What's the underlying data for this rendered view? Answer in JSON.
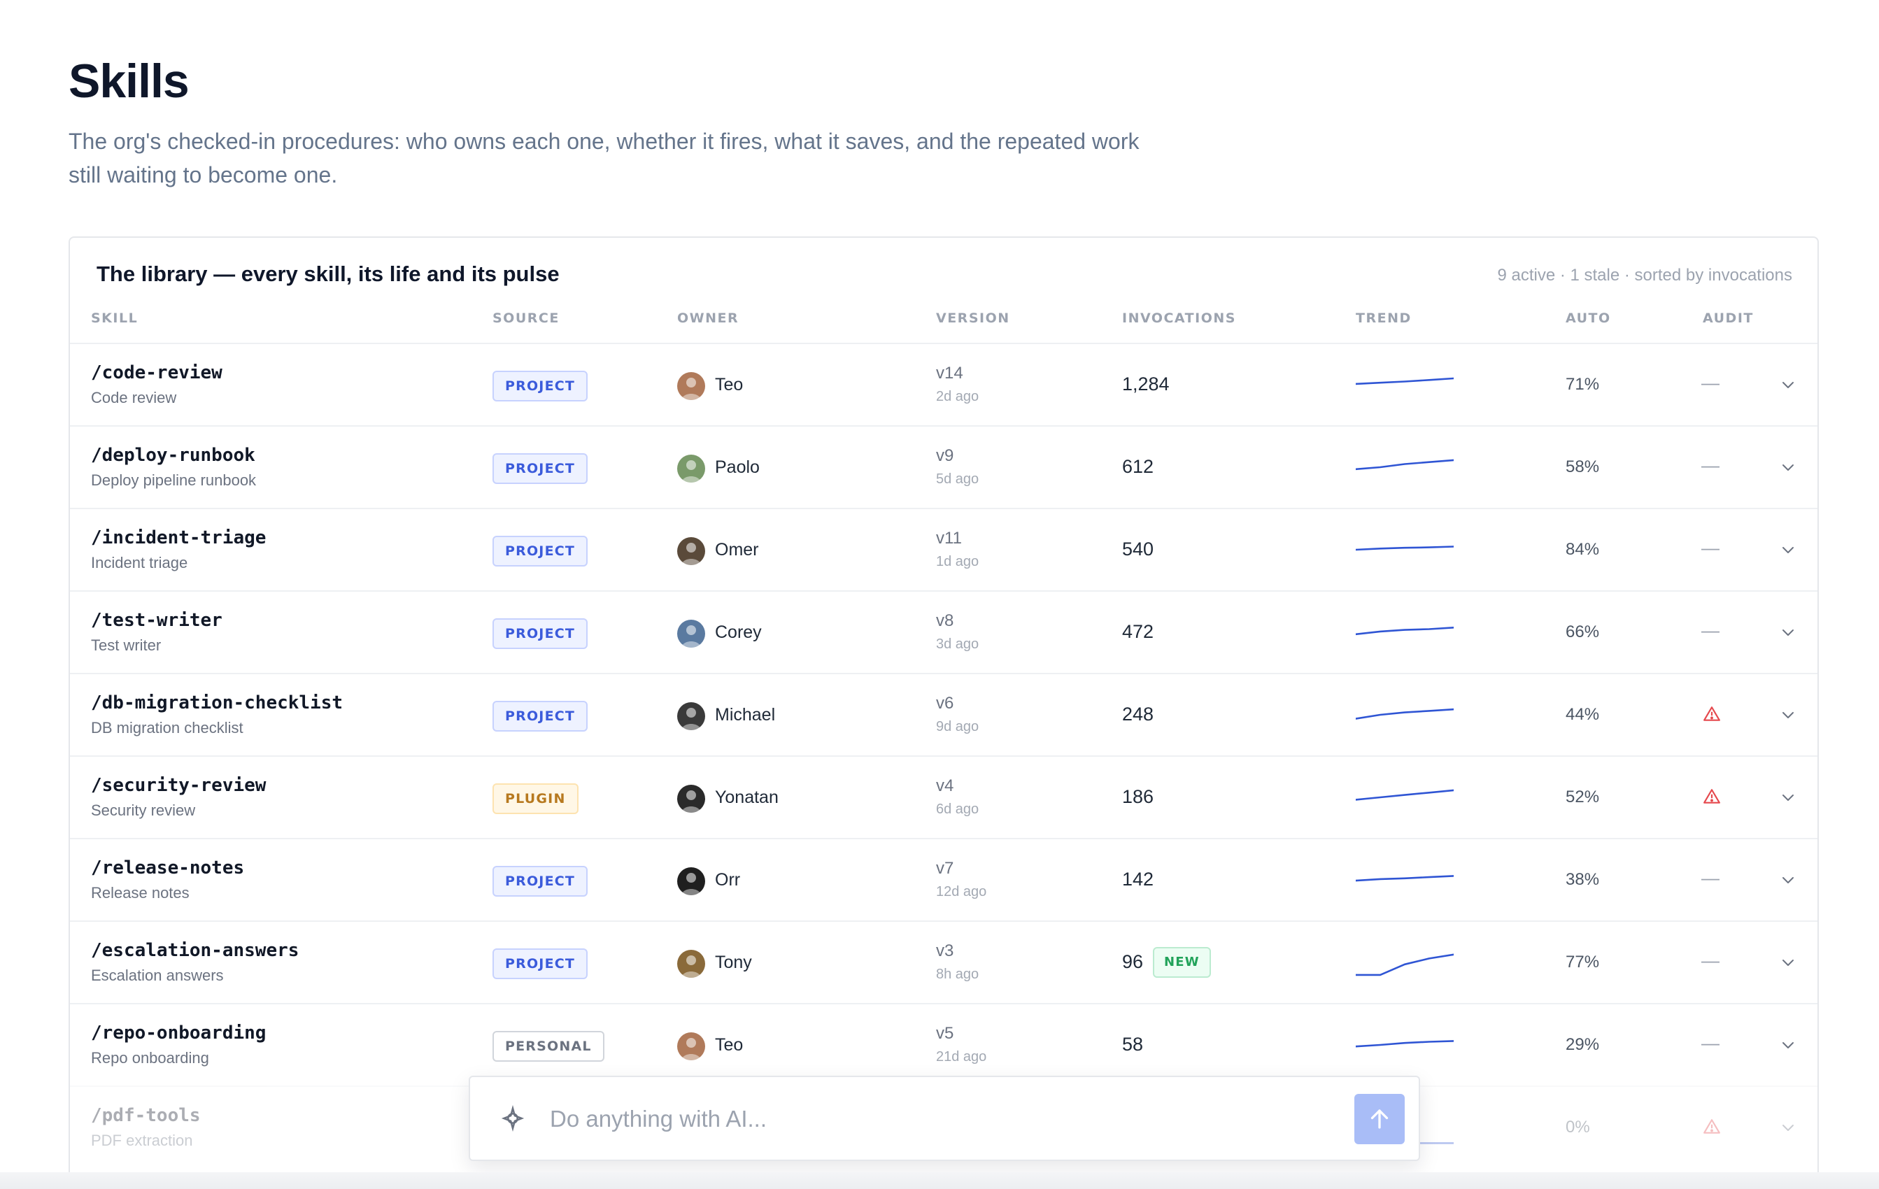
{
  "header": {
    "title": "Skills",
    "description": "The org's checked-in procedures: who owns each one, whether it fires, what it saves, and the repeated work still waiting to become one."
  },
  "library": {
    "title": "The library — every skill, its life and its pulse",
    "meta": "9 active · 1 stale · sorted by invocations",
    "columns": {
      "skill": "SKILL",
      "source": "SOURCE",
      "owner": "OWNER",
      "version": "VERSION",
      "invocations": "INVOCATIONS",
      "trend": "TREND",
      "auto": "AUTO",
      "audit": "AUDIT"
    },
    "rows": [
      {
        "name": "/code-review",
        "desc": "Code review",
        "source": "PROJECT",
        "source_kind": "project",
        "owner": "Teo",
        "avatar_color": "#b07a5a",
        "version": "v14",
        "ago": "2d ago",
        "invocations": "1,284",
        "is_new": false,
        "trend": [
          0.48,
          0.45,
          0.42,
          0.38,
          0.34
        ],
        "auto": "71%",
        "audit": "none",
        "faded": false
      },
      {
        "name": "/deploy-runbook",
        "desc": "Deploy pipeline runbook",
        "source": "PROJECT",
        "source_kind": "project",
        "owner": "Paolo",
        "avatar_color": "#7a9a6a",
        "version": "v9",
        "ago": "5d ago",
        "invocations": "612",
        "is_new": false,
        "trend": [
          0.55,
          0.5,
          0.42,
          0.37,
          0.32
        ],
        "auto": "58%",
        "audit": "none",
        "faded": false
      },
      {
        "name": "/incident-triage",
        "desc": "Incident triage",
        "source": "PROJECT",
        "source_kind": "project",
        "owner": "Omer",
        "avatar_color": "#5a4a3a",
        "version": "v11",
        "ago": "1d ago",
        "invocations": "540",
        "is_new": false,
        "trend": [
          0.5,
          0.47,
          0.45,
          0.44,
          0.42
        ],
        "auto": "84%",
        "audit": "none",
        "faded": false
      },
      {
        "name": "/test-writer",
        "desc": "Test writer",
        "source": "PROJECT",
        "source_kind": "project",
        "owner": "Corey",
        "avatar_color": "#5a7aa0",
        "version": "v8",
        "ago": "3d ago",
        "invocations": "472",
        "is_new": false,
        "trend": [
          0.55,
          0.48,
          0.44,
          0.42,
          0.38
        ],
        "auto": "66%",
        "audit": "none",
        "faded": false
      },
      {
        "name": "/db-migration-checklist",
        "desc": "DB migration checklist",
        "source": "PROJECT",
        "source_kind": "project",
        "owner": "Michael",
        "avatar_color": "#3a3a3a",
        "version": "v6",
        "ago": "9d ago",
        "invocations": "248",
        "is_new": false,
        "trend": [
          0.6,
          0.5,
          0.44,
          0.4,
          0.36
        ],
        "auto": "44%",
        "audit": "warning",
        "faded": false
      },
      {
        "name": "/security-review",
        "desc": "Security review",
        "source": "PLUGIN",
        "source_kind": "plugin",
        "owner": "Yonatan",
        "avatar_color": "#2a2a2a",
        "version": "v4",
        "ago": "6d ago",
        "invocations": "186",
        "is_new": false,
        "trend": [
          0.56,
          0.5,
          0.44,
          0.38,
          0.32
        ],
        "auto": "52%",
        "audit": "warning",
        "faded": false
      },
      {
        "name": "/release-notes",
        "desc": "Release notes",
        "source": "PROJECT",
        "source_kind": "project",
        "owner": "Orr",
        "avatar_color": "#1f1f1f",
        "version": "v7",
        "ago": "12d ago",
        "invocations": "142",
        "is_new": false,
        "trend": [
          0.52,
          0.48,
          0.46,
          0.43,
          0.4
        ],
        "auto": "38%",
        "audit": "none",
        "faded": false
      },
      {
        "name": "/escalation-answers",
        "desc": "Escalation answers",
        "source": "PROJECT",
        "source_kind": "project",
        "owner": "Tony",
        "avatar_color": "#8a6a3a",
        "version": "v3",
        "ago": "8h ago",
        "invocations": "96",
        "is_new": true,
        "new_label": "NEW",
        "trend": [
          0.82,
          0.82,
          0.55,
          0.4,
          0.3
        ],
        "auto": "77%",
        "audit": "none",
        "faded": false
      },
      {
        "name": "/repo-onboarding",
        "desc": "Repo onboarding",
        "source": "PERSONAL",
        "source_kind": "personal",
        "owner": "Teo",
        "avatar_color": "#b07a5a",
        "version": "v5",
        "ago": "21d ago",
        "invocations": "58",
        "is_new": false,
        "trend": [
          0.54,
          0.5,
          0.45,
          0.42,
          0.4
        ],
        "auto": "29%",
        "audit": "none",
        "faded": false
      },
      {
        "name": "/pdf-tools",
        "desc": "PDF extraction",
        "source": "",
        "source_kind": "none",
        "owner": "",
        "avatar_color": "",
        "version": "",
        "ago": "",
        "invocations": "",
        "is_new": false,
        "trend": [
          0.9,
          0.9,
          0.9,
          0.9,
          0.9
        ],
        "auto": "0%",
        "audit": "warning",
        "faded": true
      }
    ]
  },
  "ai_bar": {
    "placeholder": "Do anything with AI..."
  },
  "colors": {
    "accent": "#3b5bdb",
    "trend_line": "#2f55d4",
    "warning": "#e5484d",
    "send_button": "#a9bdf7"
  }
}
